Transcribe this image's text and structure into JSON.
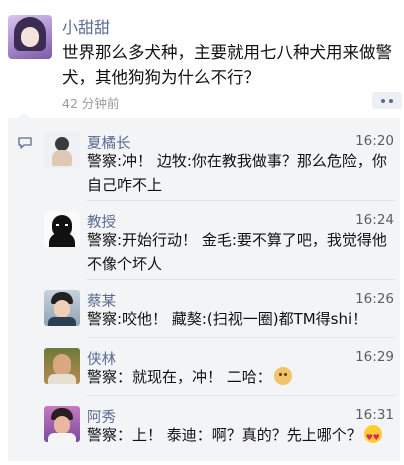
{
  "post": {
    "author": "小甜甜",
    "text": "世界那么多犬种，主要就用七八种犬用来做警犬，其他狗狗为什么不行？",
    "time": "42 分钟前"
  },
  "comments": [
    {
      "name": "夏橘长",
      "time": "16:20",
      "text": "警察:冲！ 边牧:你在教我做事？那么危险，你自己咋不上",
      "emoji": ""
    },
    {
      "name": "教授",
      "time": "16:24",
      "text": "警察:开始行动！ 金毛:要不算了吧，我觉得他不像个坏人",
      "emoji": ""
    },
    {
      "name": "蔡某",
      "time": "16:26",
      "text": "警察:咬他！ 藏獒:(扫视一圈)都TM得shi！",
      "emoji": ""
    },
    {
      "name": "侠林",
      "time": "16:29",
      "text": "警察：就现在，冲！ 二哈：",
      "emoji": "doge-emoji"
    },
    {
      "name": "阿秀",
      "time": "16:31",
      "text": "警察：上！ 泰迪：啊？真的？先上哪个？",
      "emoji": "heart-eyes-emoji"
    }
  ]
}
